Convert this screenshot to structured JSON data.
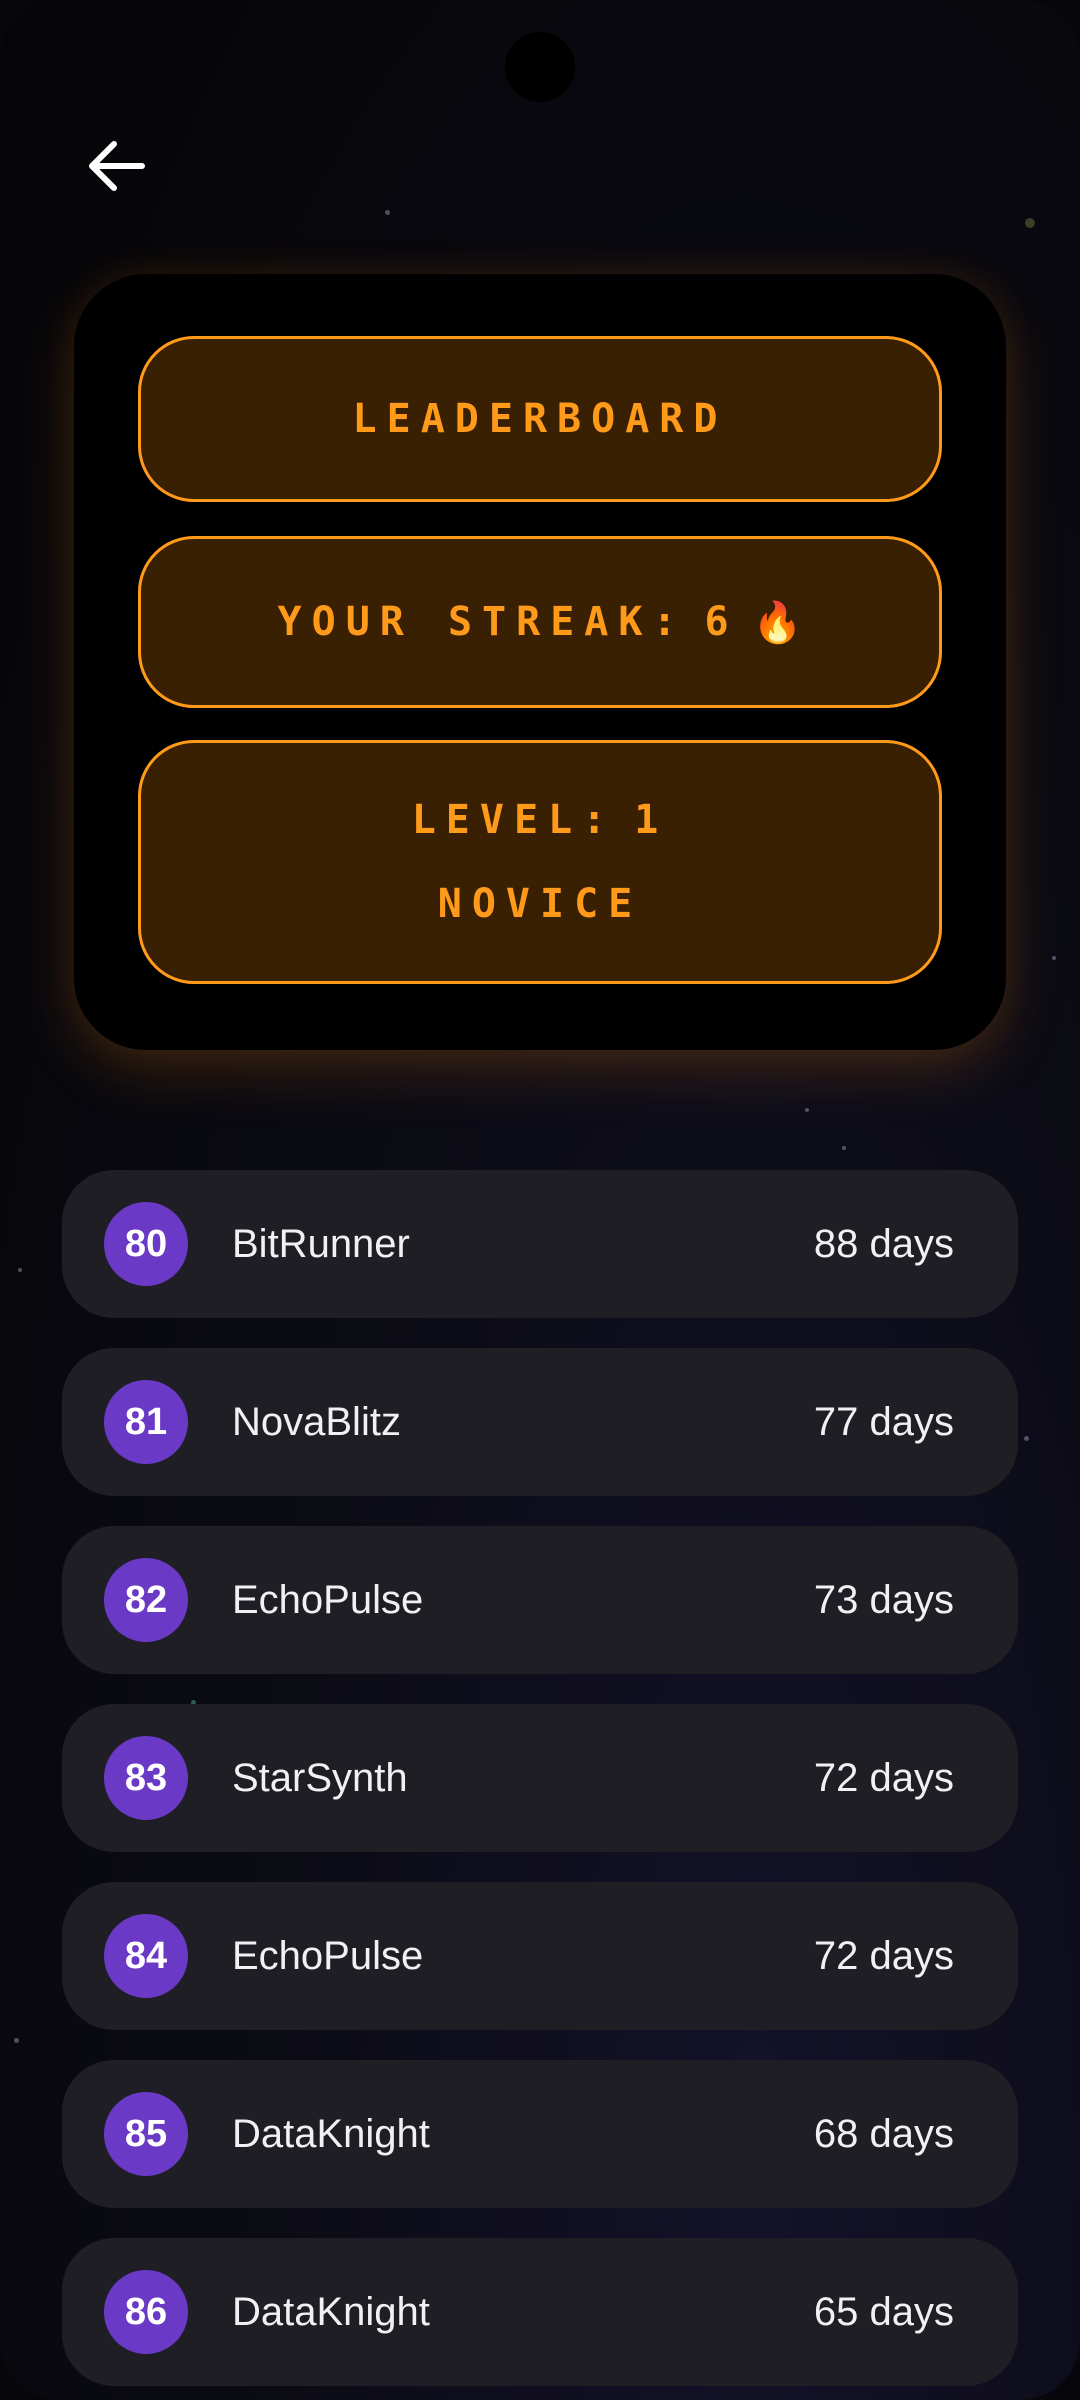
{
  "header": {
    "title": "LEADERBOARD",
    "streak_label": "YOUR STREAK:",
    "streak_value": "6",
    "streak_icon": "🔥",
    "level_label": "LEVEL:",
    "level_value": "1",
    "rank_title": "NOVICE"
  },
  "colors": {
    "accent": "#ff9a1a",
    "pill_bg": "#3a2002",
    "rank_badge": "#6a3ac6",
    "row_bg": "#1e1e24"
  },
  "leaderboard": [
    {
      "rank": "80",
      "name": "BitRunner",
      "days": "88 days"
    },
    {
      "rank": "81",
      "name": "NovaBlitz",
      "days": "77 days"
    },
    {
      "rank": "82",
      "name": "EchoPulse",
      "days": "73 days"
    },
    {
      "rank": "83",
      "name": "StarSynth",
      "days": "72 days"
    },
    {
      "rank": "84",
      "name": "EchoPulse",
      "days": "72 days"
    },
    {
      "rank": "85",
      "name": "DataKnight",
      "days": "68 days"
    },
    {
      "rank": "86",
      "name": "DataKnight",
      "days": "65 days"
    }
  ]
}
